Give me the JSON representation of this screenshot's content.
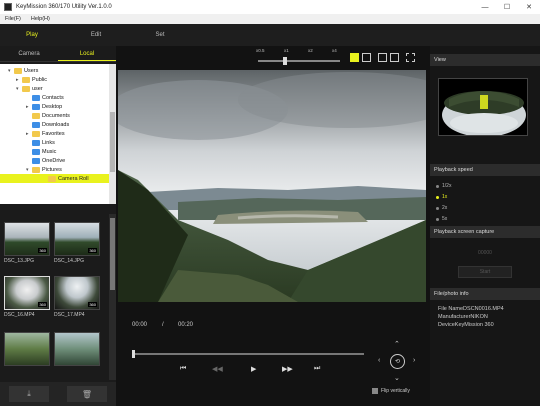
{
  "window": {
    "title": "KeyMission 360/170 Utility Ver.1.0.0",
    "minimize": "—",
    "maximize": "☐",
    "close": "✕"
  },
  "menu": [
    "File(F)",
    "Help(H)"
  ],
  "modes": [
    {
      "label": "Play",
      "active": true
    },
    {
      "label": "Edit",
      "active": false
    },
    {
      "label": "Set",
      "active": false
    }
  ],
  "source_tabs": [
    {
      "label": "Camera",
      "active": false
    },
    {
      "label": "Local",
      "active": true
    }
  ],
  "tree": [
    {
      "label": "Users",
      "indent": 1,
      "arrow": "▾",
      "color": "yellow"
    },
    {
      "label": "Public",
      "indent": 2,
      "arrow": "▸",
      "color": "yellow"
    },
    {
      "label": "user",
      "indent": 2,
      "arrow": "▾",
      "color": "yellow"
    },
    {
      "label": "Contacts",
      "indent": 3,
      "arrow": "",
      "color": "blue"
    },
    {
      "label": "Desktop",
      "indent": 3,
      "arrow": "▸",
      "color": "blue"
    },
    {
      "label": "Documents",
      "indent": 3,
      "arrow": "",
      "color": "yellow"
    },
    {
      "label": "Downloads",
      "indent": 3,
      "arrow": "",
      "color": "blue"
    },
    {
      "label": "Favorites",
      "indent": 3,
      "arrow": "▸",
      "color": "yellow"
    },
    {
      "label": "Links",
      "indent": 3,
      "arrow": "",
      "color": "blue"
    },
    {
      "label": "Music",
      "indent": 3,
      "arrow": "",
      "color": "blue"
    },
    {
      "label": "OneDrive",
      "indent": 3,
      "arrow": "",
      "color": "blue"
    },
    {
      "label": "Pictures",
      "indent": 3,
      "arrow": "▾",
      "color": "yellow"
    },
    {
      "label": "Camera Roll",
      "indent": 4,
      "arrow": "",
      "color": "yellow",
      "selected": true
    }
  ],
  "thumbnails": [
    {
      "label": "DSC_13.JPG",
      "badge": "360",
      "selected": false
    },
    {
      "label": "DSC_14.JPG",
      "badge": "360",
      "selected": false
    },
    {
      "label": "DSC_16.MP4",
      "badge": "360",
      "selected": true
    },
    {
      "label": "DSC_17.MP4",
      "badge": "360",
      "selected": false
    },
    {
      "label": "",
      "badge": "",
      "selected": false
    },
    {
      "label": "",
      "badge": "",
      "selected": false
    }
  ],
  "left_actions": {
    "download": "⤓",
    "delete": "🗑"
  },
  "speed_scale": [
    "x0.5",
    "x1",
    "x2",
    "x4"
  ],
  "view_modes_selected_index": 0,
  "playback": {
    "current_time": "00:00",
    "separator": "/",
    "total_time": "00:20",
    "progress": 0.0,
    "buttons": {
      "prev": "⏮",
      "rewind": "◀◀",
      "play": "▶",
      "forward": "▶▶",
      "next": "⏭"
    },
    "dpad": {
      "up": "⌃",
      "down": "⌄",
      "left": "‹",
      "right": "›",
      "center": "⟲"
    },
    "flip_label": "Flip vertically"
  },
  "right_panel": {
    "view_header": "View",
    "speed_header": "Playback speed",
    "speed_options": [
      {
        "label": "1/2x",
        "selected": false
      },
      {
        "label": "1x",
        "selected": true
      },
      {
        "label": "2x",
        "selected": false
      },
      {
        "label": "5x",
        "selected": false
      }
    ],
    "capture_header": "Playback screen capture",
    "capture_count": "00000",
    "capture_button": "Start",
    "info_header": "File/photo info",
    "info_lines": [
      "File NameDSCN0016.MP4",
      "ManufacturerNIKON",
      "DeviceKeyMission 360"
    ]
  },
  "colors": {
    "accent": "#e9f21e",
    "background": "#1a1a1a"
  }
}
